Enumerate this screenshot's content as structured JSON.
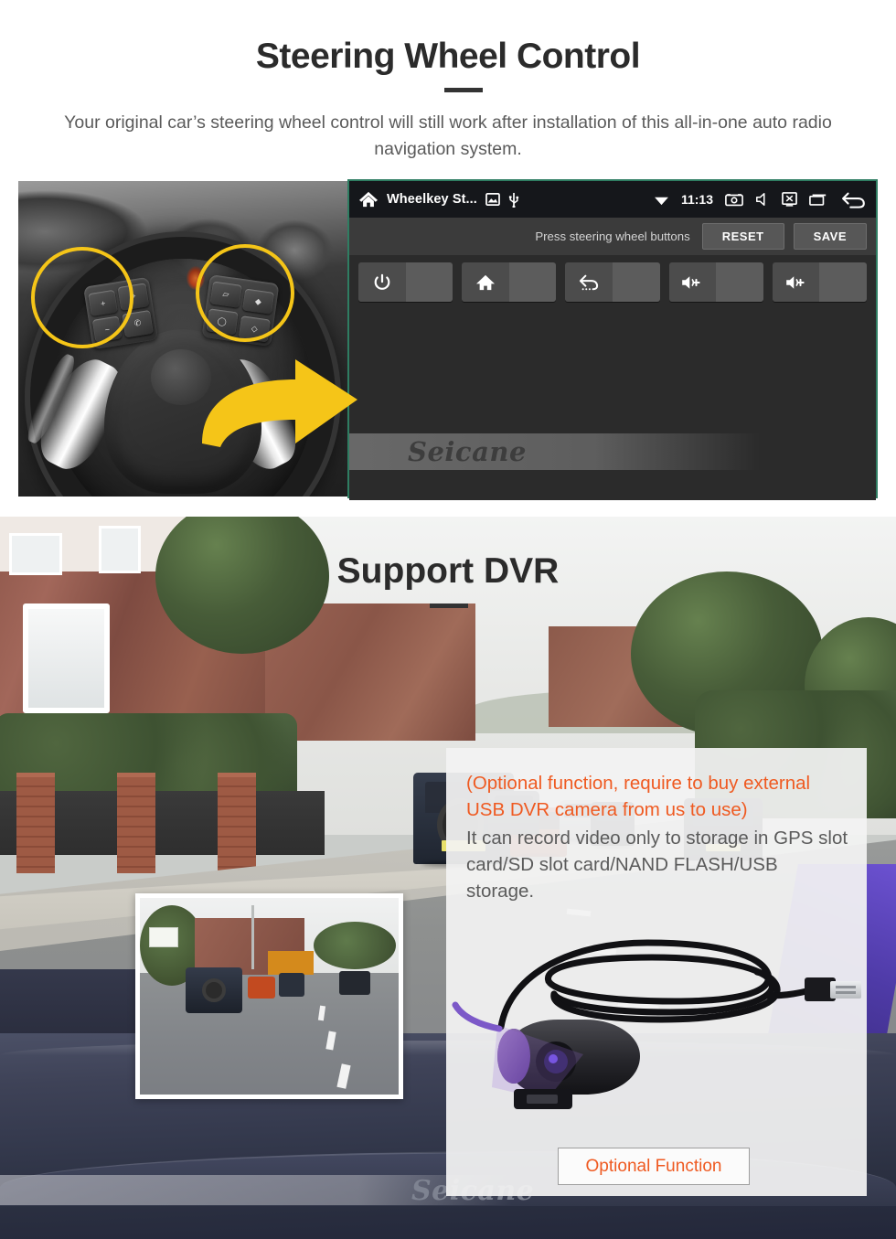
{
  "sections": {
    "steering_wheel": {
      "title": "Steering Wheel Control",
      "subtitle": "Your original car’s steering wheel control will still work after installation of this all-in-one auto radio navigation system.",
      "head_unit": {
        "status_bar": {
          "home_icon": "home-icon",
          "app_title": "Wheelkey St...",
          "image_icon": "image-icon",
          "usb_icon": "usb-icon",
          "wifi_icon": "wifi-icon",
          "time": "11:13",
          "screenshot_icon": "screenshot-icon",
          "mute_icon": "mute-icon",
          "screen-off_icon": "screen-off-icon",
          "recents_icon": "recent-apps-icon",
          "back_icon": "back-arrow-icon"
        },
        "action_bar": {
          "prompt": "Press steering wheel buttons",
          "reset_label": "RESET",
          "save_label": "SAVE"
        },
        "keys": [
          {
            "name": "power",
            "icon": "power-icon",
            "value": ""
          },
          {
            "name": "home",
            "icon": "home-icon",
            "value": ""
          },
          {
            "name": "back",
            "icon": "back-undo-icon",
            "value": ""
          },
          {
            "name": "volume-up-1",
            "icon": "volume-up-icon",
            "value": ""
          },
          {
            "name": "volume-up-2",
            "icon": "volume-up-icon",
            "value": ""
          }
        ],
        "watermark": "Seicane"
      },
      "photo": {
        "highlight_color": "#F5C518",
        "arrow_color": "#F5C518",
        "left_pad_keys": [
          "+",
          "−",
          "mode",
          "phone"
        ],
        "right_pad_keys": [
          "cruise",
          "up",
          "menu",
          "down"
        ]
      }
    },
    "support_dvr": {
      "title": "Support DVR",
      "card": {
        "warning_text": "(Optional function, require to buy external USB DVR camera from us to use)",
        "body_text": "It can record video only to storage in GPS slot card/SD slot card/NAND FLASH/USB storage.",
        "warning_color": "#ef5a21",
        "body_color": "#5b5b5b",
        "optional_button_label": "Optional Function"
      },
      "watermark": "Seicane"
    }
  }
}
